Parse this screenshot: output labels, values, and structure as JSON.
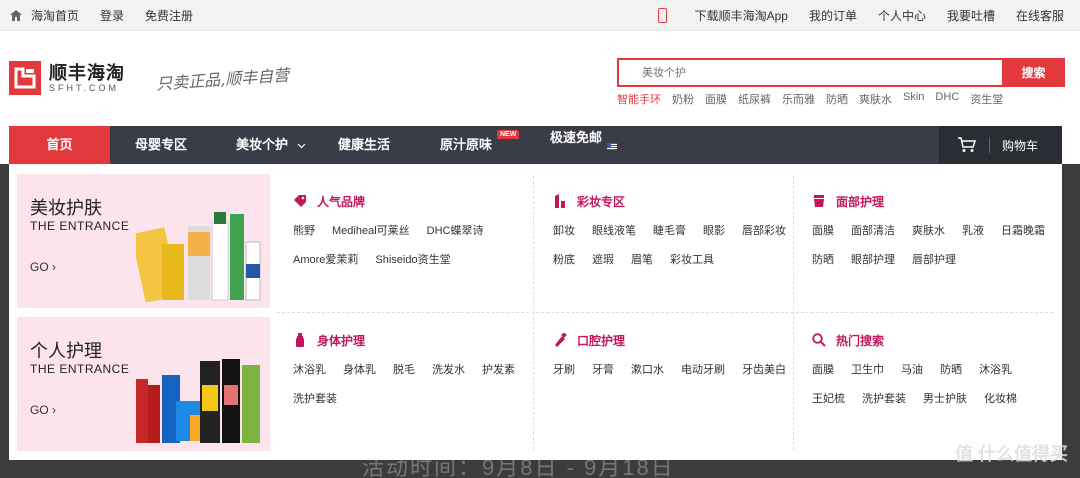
{
  "topbar": {
    "left": [
      "海淘首页",
      "登录",
      "免费注册"
    ],
    "app_link": "下载顺丰海淘App",
    "right": [
      "我的订单",
      "个人中心",
      "我要吐槽",
      "在线客服"
    ]
  },
  "logo": {
    "cn": "顺丰海淘",
    "en": "SFHT.COM"
  },
  "slogan": "只卖正品,顺丰自营",
  "search": {
    "placeholder": "美妆个护",
    "button": "搜索"
  },
  "hotwords": [
    "智能手环",
    "奶粉",
    "面膜",
    "纸尿裤",
    "乐而雅",
    "防晒",
    "爽肤水",
    "Skin",
    "DHC",
    "资生堂"
  ],
  "nav": {
    "items": [
      "首页",
      "母婴专区",
      "美妆个护",
      "健康生活",
      "原汁原味",
      "极速免邮"
    ],
    "new_badge": "NEW",
    "cart": "购物车"
  },
  "banners": [
    {
      "title": "美妆护肤",
      "sub": "THE ENTRANCE",
      "go": "GO"
    },
    {
      "title": "个人护理",
      "sub": "THE ENTRANCE",
      "go": "GO"
    }
  ],
  "categories": [
    {
      "title": "人气品牌",
      "links": [
        "熊野",
        "Mediheal可莱丝",
        "DHC蝶翠诗",
        "Amore爱茉莉",
        "Shiseido资生堂"
      ]
    },
    {
      "title": "彩妆专区",
      "links": [
        "卸妆",
        "眼线液笔",
        "睫毛膏",
        "眼影",
        "唇部彩妆",
        "粉底",
        "遮瑕",
        "眉笔",
        "彩妆工具"
      ]
    },
    {
      "title": "面部护理",
      "links": [
        "面膜",
        "面部清洁",
        "爽肤水",
        "乳液",
        "日霜晚霜",
        "防晒",
        "眼部护理",
        "唇部护理"
      ]
    },
    {
      "title": "身体护理",
      "links": [
        "沐浴乳",
        "身体乳",
        "脱毛",
        "洗发水",
        "护发素",
        "洗护套装"
      ]
    },
    {
      "title": "口腔护理",
      "links": [
        "牙刷",
        "牙膏",
        "漱口水",
        "电动牙刷",
        "牙齿美白"
      ]
    },
    {
      "title": "热门搜索",
      "links": [
        "面膜",
        "卫生巾",
        "马油",
        "防晒",
        "沐浴乳",
        "王妃梳",
        "洗护套装",
        "男士护肤",
        "化妆棉"
      ]
    }
  ],
  "background_text": "活动时间：9月8日 - 9月18日",
  "watermark": "值 什么值得买",
  "colors": {
    "brand_red": "#e4393c",
    "nav_dark": "#3a3d48",
    "category_title": "#c2185b",
    "banner_pink": "#fce4ec"
  }
}
